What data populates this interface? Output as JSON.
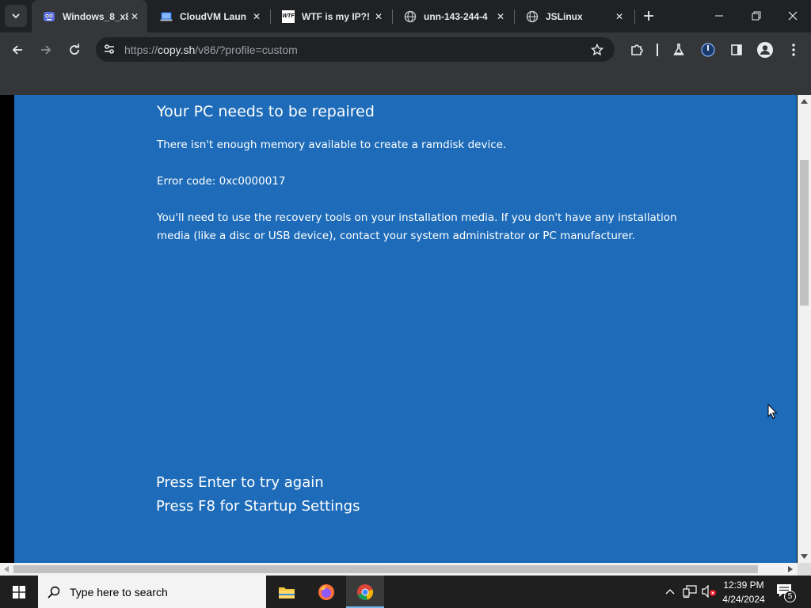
{
  "browser": {
    "tabs": [
      {
        "title": "Windows_8_x8",
        "active": true,
        "favicon": "v86-icon"
      },
      {
        "title": "CloudVM Laun",
        "active": false,
        "favicon": "laptop-icon"
      },
      {
        "title": "WTF is my IP?!",
        "active": false,
        "favicon": "wtf-icon"
      },
      {
        "title": "unn-143-244-4",
        "active": false,
        "favicon": "globe-icon"
      },
      {
        "title": "JSLinux",
        "active": false,
        "favicon": "globe-icon"
      }
    ],
    "favicon_wtf_text": "WTF",
    "url": "https://copy.sh/v86/?profile=custom",
    "url_host": "copy.sh",
    "url_scheme": "https://",
    "url_path": "/v86/?profile=custom"
  },
  "bsod": {
    "heading": "Your PC needs to be repaired",
    "line1": "There isn't enough memory available to create a ramdisk device.",
    "error_code": "Error code: 0xc0000017",
    "para_line1": "You'll need to use the recovery tools on your installation media. If you don't have any installation",
    "para_line2": "media (like a disc or USB device), contact your system administrator or PC manufacturer.",
    "option1": "Press Enter to try again",
    "option2": "Press F8 for Startup Settings",
    "background": "#1e6cb9"
  },
  "taskbar": {
    "search_placeholder": "Type here to search",
    "time": "12:39 PM",
    "date": "4/24/2024",
    "notification_count": "5"
  }
}
